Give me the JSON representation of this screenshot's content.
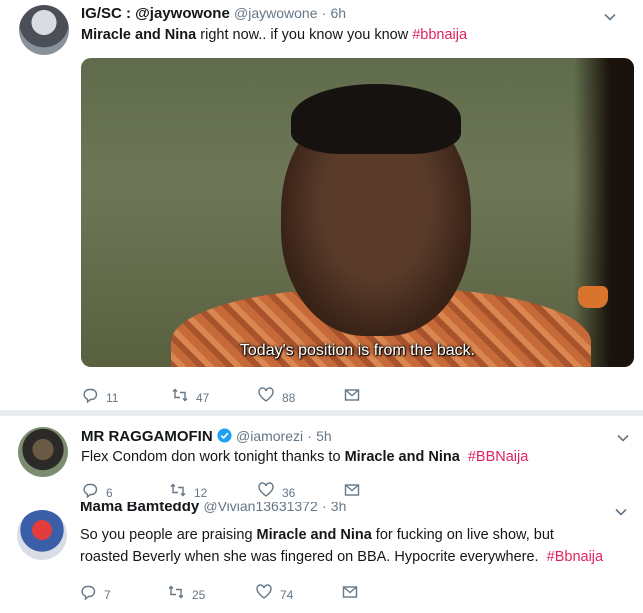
{
  "tweets": [
    {
      "display_name": "IG/SC : @jaywowone",
      "handle": "@jaywowone",
      "dot": "·",
      "time": "6h",
      "text_bold": "Miracle and Nina",
      "text_rest": " right now.. if you know you know ",
      "hashtag": "#bbnaija",
      "media_caption": "Today's position is from the back.",
      "replies": "11",
      "retweets": "47",
      "likes": "88"
    },
    {
      "display_name": "MR RAGGAMOFIN",
      "handle": "@iamorezi",
      "dot": "·",
      "time": "5h",
      "text_pre": "Flex Condom don work tonight thanks to ",
      "text_bold": "Miracle and Nina",
      "text_post": "  ",
      "hashtag": "#BBNaija",
      "replies": "6",
      "retweets": "12",
      "likes": "36"
    },
    {
      "display_name": "Mama Bamteddy",
      "handle": "@Vivian13631372",
      "dot": "·",
      "time": "3h",
      "text_pre": "So you people are praising ",
      "text_bold": "Miracle and Nina",
      "text_line1_post": " for fucking on live show, but",
      "text_line2": "roasted Beverly when she was fingered on BBA. Hypocrite everywhere.  ",
      "hashtag": "#Bbnaija",
      "replies": "7",
      "retweets": "25",
      "likes": "74"
    }
  ],
  "colors": {
    "hashtag": "#e0245e",
    "muted": "#657786",
    "verified": "#1da1f2",
    "separator": "#e6ecf0"
  },
  "icons": [
    "reply-icon",
    "retweet-icon",
    "like-icon",
    "message-icon",
    "chevron-down-icon",
    "verified-icon"
  ]
}
